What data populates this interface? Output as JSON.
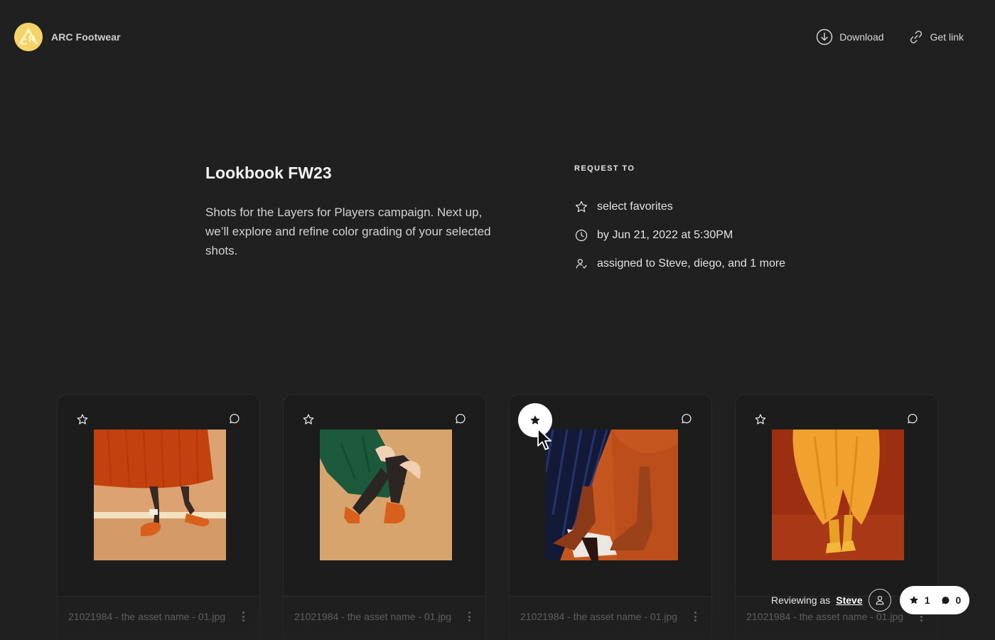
{
  "brand": {
    "name": "ARC Footwear",
    "logo_text": "CR",
    "logo_color": "#f3d36a"
  },
  "header": {
    "download_label": "Download",
    "get_link_label": "Get link"
  },
  "intro": {
    "title": "Lookbook FW23",
    "description": "Shots for the Layers for Players campaign. Next up, we’ll explore and refine color grading of your selected shots."
  },
  "request": {
    "heading": "REQUEST TO",
    "items": [
      {
        "icon": "star-outline-icon",
        "text": "select favorites"
      },
      {
        "icon": "clock-icon",
        "text": "by Jun 21, 2022 at 5:30PM"
      },
      {
        "icon": "user-check-icon",
        "text": "assigned to Steve, diego, and 1 more"
      }
    ]
  },
  "cards": [
    {
      "file_name": "21021984 - the asset name - 01.jpg",
      "starred": false
    },
    {
      "file_name": "21021984 - the asset name - 01.jpg",
      "starred": false
    },
    {
      "file_name": "21021984 - the asset name - 01.jpg",
      "starred": true
    },
    {
      "file_name": "21021984 - the asset name - 01.jpg",
      "starred": false
    }
  ],
  "footer": {
    "reviewing_prefix": "Reviewing as",
    "reviewer": "Steve",
    "star_count": "1",
    "comment_count": "0"
  }
}
